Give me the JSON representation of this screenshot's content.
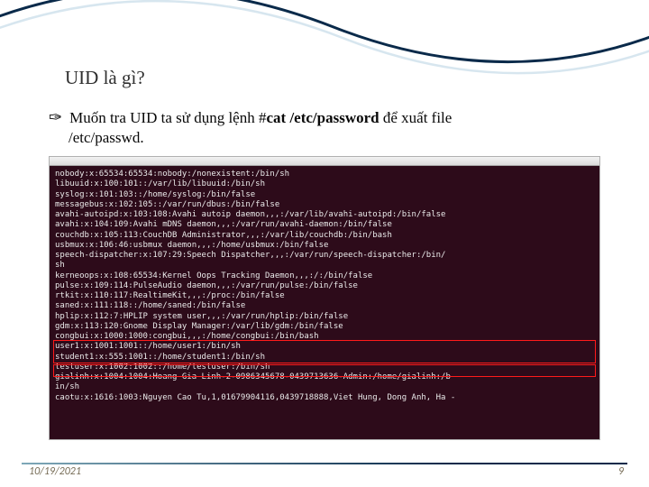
{
  "slide": {
    "title": "UID là gì?",
    "bullet_prefix": "Muốn tra UID ta sử dụng lệnh ",
    "bullet_cmd_hash": "#",
    "bullet_cmd_name": "cat /etc/password",
    "bullet_suffix": " để xuất file",
    "bullet_line2": "/etc/passwd."
  },
  "terminal": {
    "lines": [
      "nobody:x:65534:65534:nobody:/nonexistent:/bin/sh",
      "libuuid:x:100:101::/var/lib/libuuid:/bin/sh",
      "syslog:x:101:103::/home/syslog:/bin/false",
      "messagebus:x:102:105::/var/run/dbus:/bin/false",
      "avahi-autoipd:x:103:108:Avahi autoip daemon,,,:/var/lib/avahi-autoipd:/bin/false",
      "avahi:x:104:109:Avahi mDNS daemon,,,:/var/run/avahi-daemon:/bin/false",
      "couchdb:x:105:113:CouchDB Administrator,,,:/var/lib/couchdb:/bin/bash",
      "usbmux:x:106:46:usbmux daemon,,,:/home/usbmux:/bin/false",
      "speech-dispatcher:x:107:29:Speech Dispatcher,,,:/var/run/speech-dispatcher:/bin/",
      "sh",
      "kerneoops:x:108:65534:Kernel Oops Tracking Daemon,,,:/:/bin/false",
      "pulse:x:109:114:PulseAudio daemon,,,:/var/run/pulse:/bin/false",
      "rtkit:x:110:117:RealtimeKit,,,:/proc:/bin/false",
      "saned:x:111:118::/home/saned:/bin/false",
      "hplip:x:112:7:HPLIP system user,,,:/var/run/hplip:/bin/false",
      "gdm:x:113:120:Gnome Display Manager:/var/lib/gdm:/bin/false",
      "congbui:x:1000:1000:congbui,,,:/home/congbui:/bin/bash",
      "user1:x:1001:1001::/home/user1:/bin/sh",
      "student1:x:555:1001::/home/student1:/bin/sh",
      "testuser:x:1002:1002::/home/testuser:/bin/sh",
      "gialinh:x:1004:1004:Hoang Gia Linh-2-0986345678-0439713636-Admin:/home/gialinh:/b",
      "in/sh",
      "caotu:x:1616:1003:Nguyen Cao Tu,1,01679904116,0439718888,Viet Hung, Dong Anh, Ha -"
    ]
  },
  "footer": {
    "date": "10/19/2021",
    "page": "9"
  }
}
